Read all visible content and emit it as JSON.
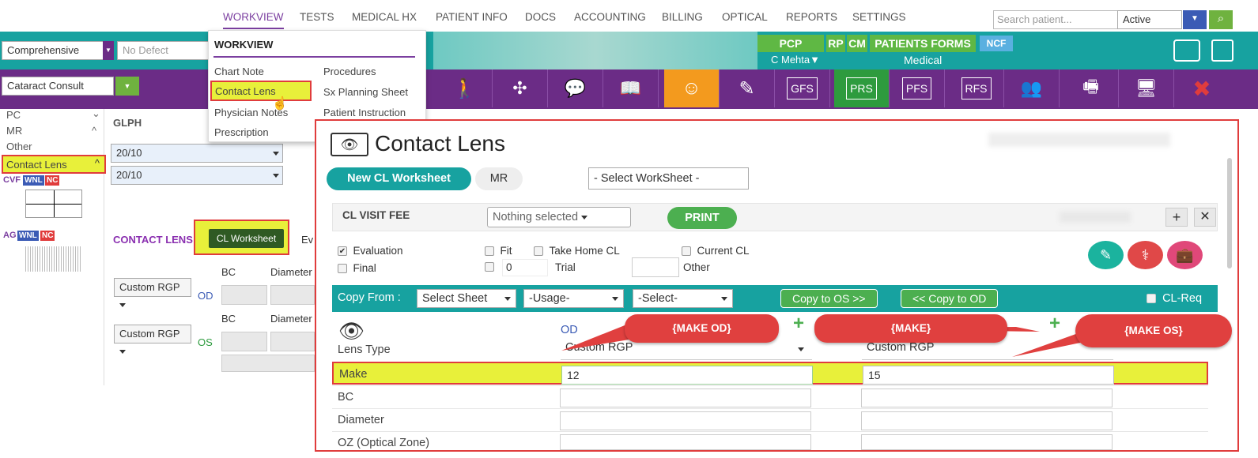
{
  "nav": {
    "items": [
      "WORKVIEW",
      "TESTS",
      "MEDICAL HX",
      "PATIENT INFO",
      "DOCS",
      "ACCOUNTING",
      "BILLING",
      "OPTICAL",
      "REPORTS",
      "SETTINGS"
    ]
  },
  "search": {
    "placeholder": "Search patient...",
    "status": "Active"
  },
  "top": {
    "exam_type": "Comprehensive",
    "defect": "No Defect",
    "visit": "Cataract Consult",
    "pcp": "PCP",
    "rp": "RP",
    "cm": "CM",
    "patients_forms": "PATIENTS FORMS",
    "ncf": "NCF",
    "doctor": "C Mehta▼",
    "medical": "Medical"
  },
  "toolbar": {
    "gfs": "GFS",
    "prs": "PRS",
    "pfs": "PFS",
    "rfs": "RFS"
  },
  "menu": {
    "header": "WORKVIEW",
    "col1": [
      "Chart Note",
      "Contact Lens",
      "Physician Notes",
      "Prescription"
    ],
    "col2": [
      "Procedures",
      "Sx Planning Sheet",
      "Patient Instruction"
    ]
  },
  "left": {
    "items": [
      "PC",
      "MR",
      "Other",
      "Contact Lens"
    ],
    "cvf": "CVF",
    "wnl": "WNL",
    "nc": "NC",
    "ag": "AG",
    "glph": "GLPH",
    "v1": "20/10",
    "v2": "20/10",
    "contact_lens": "CONTACT LENS",
    "cl_worksheet": "CL Worksheet",
    "ev": "Ev",
    "rgp": "Custom RGP",
    "od": "OD",
    "os": "OS",
    "bc": "BC",
    "diameter": "Diameter"
  },
  "dialog": {
    "title": "Contact Lens",
    "new_ws": "New CL Worksheet",
    "mr": "MR",
    "select_ws": "- Select WorkSheet -",
    "visit_fee": "CL VISIT FEE",
    "nothing_selected": "Nothing selected",
    "print": "PRINT",
    "checks": {
      "evaluation": "Evaluation",
      "fit": "Fit",
      "take_home": "Take Home CL",
      "current": "Current CL",
      "final": "Final",
      "zero": "0",
      "trial": "Trial",
      "other": "Other"
    },
    "copy_from": "Copy From :",
    "select_sheet": "Select Sheet",
    "usage": "-Usage-",
    "select": "-Select-",
    "copy_os": "Copy to OS >>",
    "copy_od": "<< Copy to OD",
    "cl_req": "CL-Req",
    "od": "OD",
    "lens_type": "Lens Type",
    "lens_od": "Custom RGP",
    "lens_os": "Custom RGP",
    "rows": [
      {
        "label": "Make",
        "od": "12",
        "os": "15"
      },
      {
        "label": "BC",
        "od": "",
        "os": ""
      },
      {
        "label": "Diameter",
        "od": "",
        "os": ""
      },
      {
        "label": "OZ (Optical Zone)",
        "od": "",
        "os": ""
      }
    ]
  },
  "callouts": {
    "make_od": "{MAKE OD}",
    "make": "{MAKE}",
    "make_os": "{MAKE OS}"
  },
  "colors": {
    "purple": "#6b2c86",
    "teal": "#17a2a0",
    "green": "#4caf50",
    "red": "#e03c3c",
    "highlight": "#e8f03a"
  }
}
